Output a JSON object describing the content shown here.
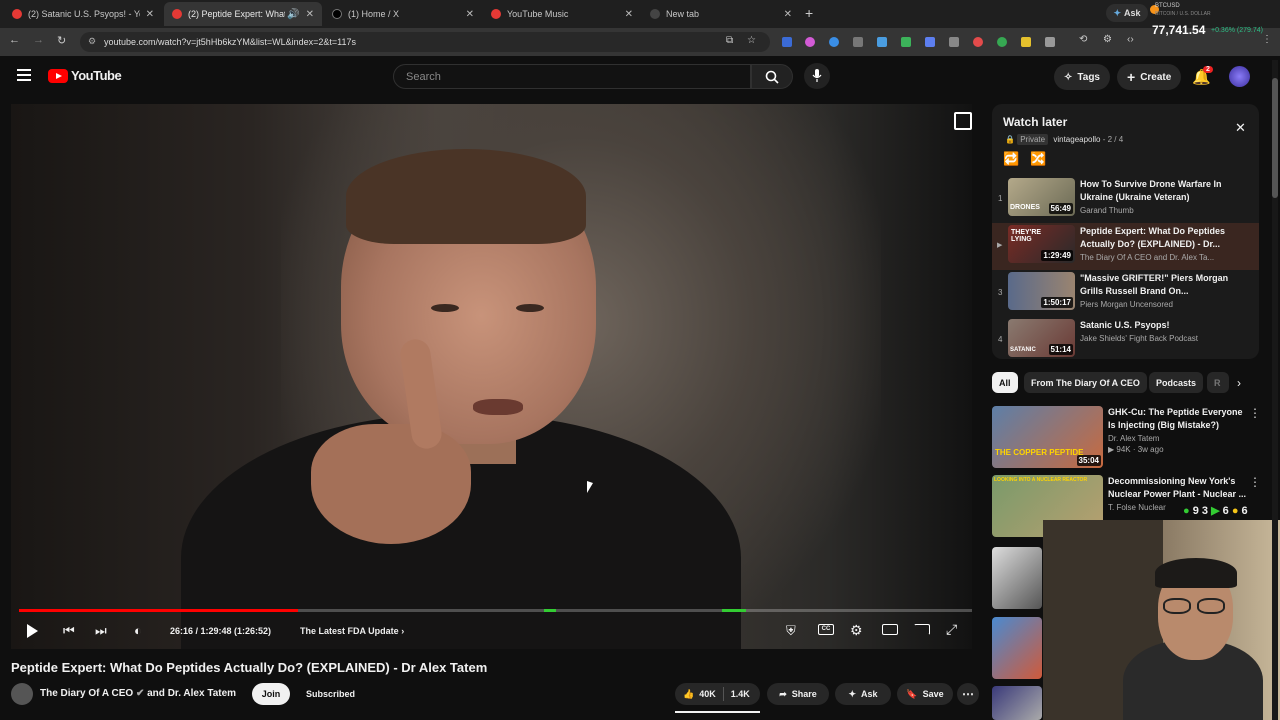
{
  "browser": {
    "tabs": [
      {
        "title": "(2) Satanic U.S. Psyops! - YouTu",
        "color": "#e53935"
      },
      {
        "title": "(2) Peptide Expert: What Do",
        "color": "#e53935"
      },
      {
        "title": "(1) Home / X",
        "color": "#000000"
      },
      {
        "title": "YouTube Music",
        "color": "#e53935"
      },
      {
        "title": "New tab",
        "color": "#444444"
      }
    ],
    "url": "youtube.com/watch?v=jt5hHb6kzYM&list=WL&index=2&t=117s",
    "ticker": {
      "symbol": "BTCUSD",
      "subtitle": "BITCOIN / U.S. DOLLAR",
      "price": "77,741.54",
      "change": "+0.36% (279.74)",
      "ask": "Ask"
    }
  },
  "header": {
    "logo": "YouTube",
    "search_placeholder": "Search",
    "tags_label": "Tags",
    "create_label": "Create",
    "notif_count": "2"
  },
  "player": {
    "time": "26:16 / 1:29:48 (1:26:52)",
    "chapter": "The Latest FDA Update",
    "progress": 0.293
  },
  "video": {
    "title": "Peptide Expert: What Do Peptides Actually Do? (EXPLAINED) - Dr Alex Tatem",
    "channel": "The Diary Of A CEO",
    "and": "and",
    "cohost": "Dr. Alex Tatem",
    "join": "Join",
    "subscribed": "Subscribed",
    "likes": "40K",
    "comments": "1.4K",
    "share": "Share",
    "ask": "Ask",
    "save": "Save"
  },
  "watch_later": {
    "title": "Watch later",
    "privacy": "Private",
    "owner": "vintageapollo",
    "position": "2 / 4",
    "items": [
      {
        "num": "1",
        "title1": "How To Survive Drone Warfare In",
        "title2": "Ukraine (Ukraine Veteran)",
        "channel": "Garand Thumb",
        "duration": "56:49",
        "thumb_text": "DRONES"
      },
      {
        "num": "▶",
        "title1": "Peptide Expert: What Do Peptides",
        "title2": "Actually Do? (EXPLAINED) - Dr...",
        "channel": "The Diary Of A CEO and Dr. Alex Ta...",
        "duration": "1:29:49",
        "thumb_text": "THEY'RE LYING"
      },
      {
        "num": "3",
        "title1": "\"Massive GRIFTER!\" Piers Morgan",
        "title2": "Grills Russell Brand On...",
        "channel": "Piers Morgan Uncensored",
        "duration": "1:50:17",
        "thumb_text": ""
      },
      {
        "num": "4",
        "title1": "Satanic U.S. Psyops!",
        "title2": "",
        "channel": "Jake Shields' Fight Back Podcast",
        "duration": "51:14",
        "thumb_text": "SATANIC"
      }
    ]
  },
  "chips": [
    "All",
    "From The Diary Of A CEO",
    "Podcasts",
    "R"
  ],
  "recommendations": [
    {
      "title1": "GHK-Cu: The Peptide Everyone",
      "title2": "Is Injecting (Big Mistake?)",
      "channel": "Dr. Alex Tatem",
      "meta": "94K · 3w ago",
      "duration": "35:04",
      "thumb_text": "THE COPPER PEPTIDE"
    },
    {
      "title1": "Decommissioning New York's",
      "title2": "Nuclear Power Plant - Nuclear ...",
      "channel": "T. Folse Nuclear",
      "meta": "",
      "duration": "",
      "thumb_text": "LOOKING INTO A NUCLEAR REACTOR"
    }
  ],
  "overlay_stats": {
    "a": "9",
    "b": "3",
    "c": "6",
    "d": "6"
  }
}
